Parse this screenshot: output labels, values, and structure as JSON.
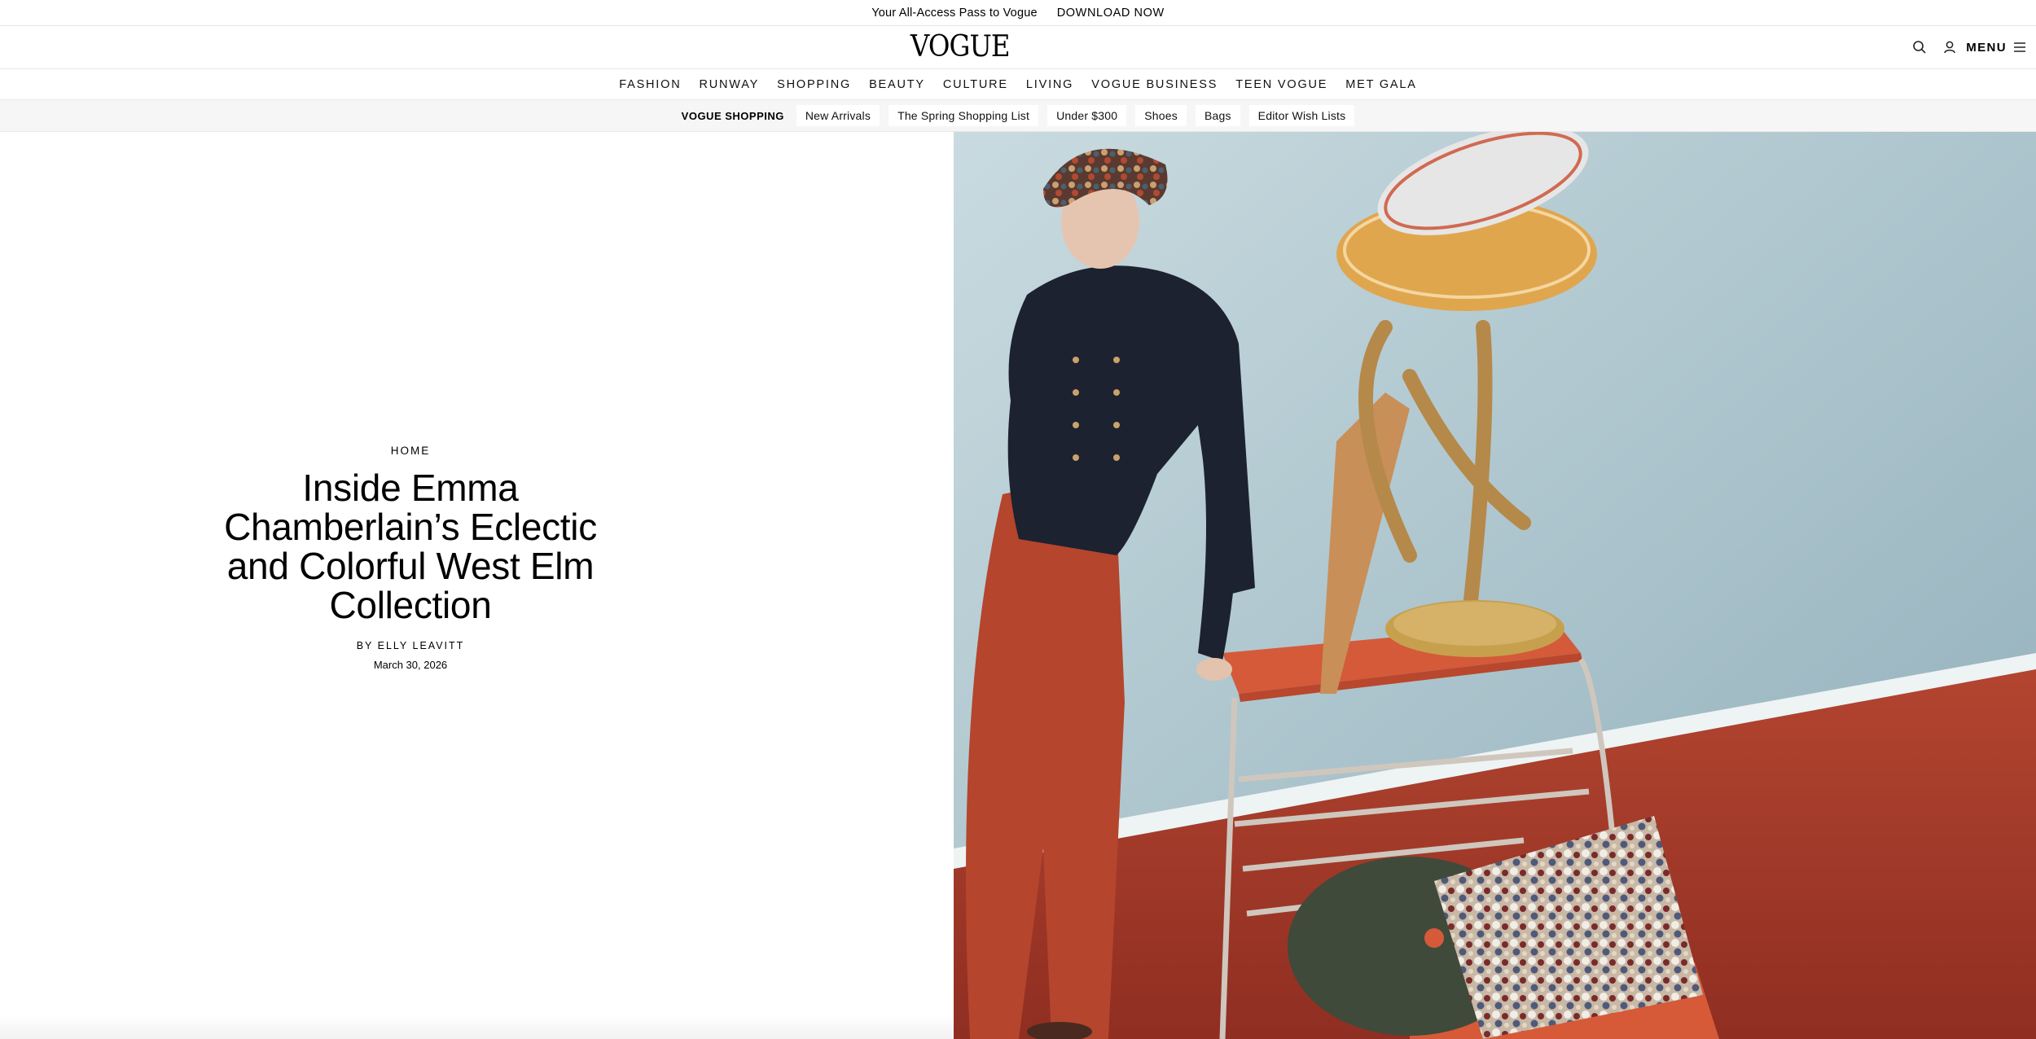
{
  "promo": {
    "text": "Your All-Access Pass to Vogue",
    "cta": "DOWNLOAD NOW"
  },
  "header": {
    "logo": "VOGUE",
    "menu_label": "MENU",
    "icons": [
      "search-icon",
      "account-icon",
      "menu-icon"
    ]
  },
  "nav": {
    "items": [
      "FASHION",
      "RUNWAY",
      "SHOPPING",
      "BEAUTY",
      "CULTURE",
      "LIVING",
      "VOGUE BUSINESS",
      "TEEN VOGUE",
      "MET GALA"
    ]
  },
  "subnav": {
    "title": "VOGUE SHOPPING",
    "items": [
      "New Arrivals",
      "The Spring Shopping List",
      "Under $300",
      "Shoes",
      "Bags",
      "Editor Wish Lists"
    ]
  },
  "article": {
    "rubric": "HOME",
    "headline": "Inside Emma Chamberlain’s Eclectic and Colorful West Elm Collection",
    "byline": "BY ELLY LEAVITT",
    "date": "March 30, 2026"
  },
  "colors": {
    "background": "#ffffff",
    "subnav_background": "#f6f6f6",
    "text": "#000000",
    "wall": "#a9c2cc",
    "carpet": "#a13a2a",
    "trousers": "#b5452c",
    "jacket": "#1c2230"
  }
}
